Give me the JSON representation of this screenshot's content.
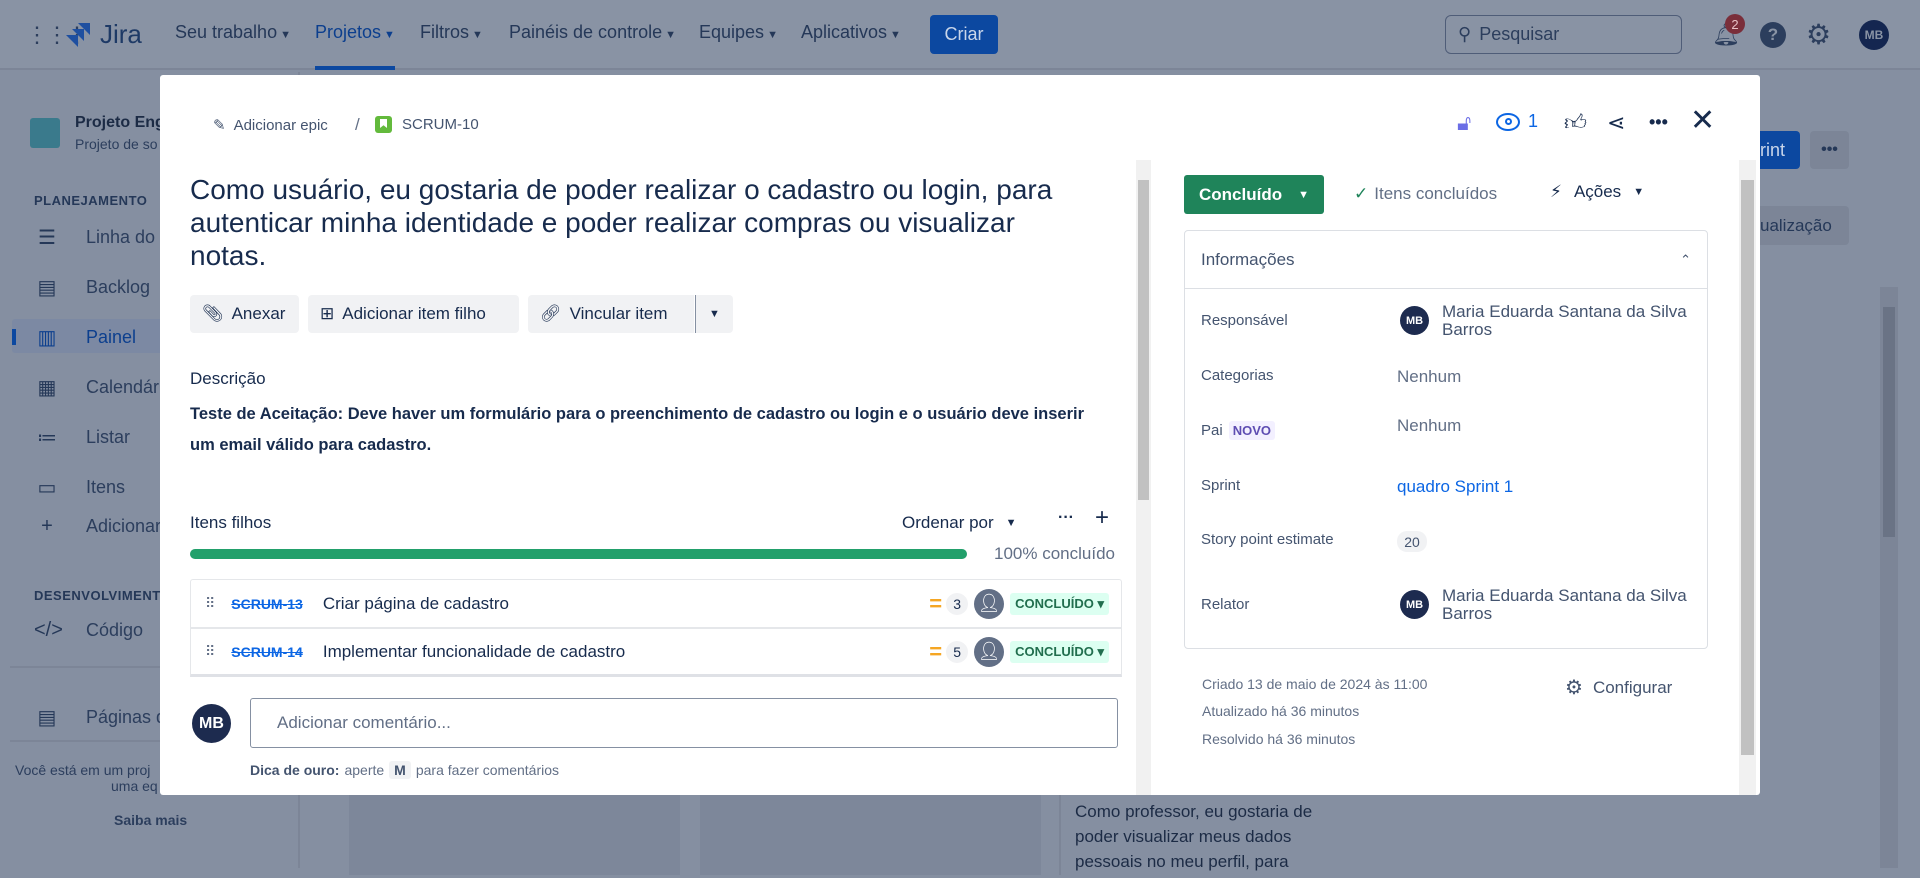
{
  "nav": {
    "product": "Jira",
    "items": [
      "Seu trabalho",
      "Projetos",
      "Filtros",
      "Painéis de controle",
      "Equipes",
      "Aplicativos"
    ],
    "active": "Projetos",
    "create": "Criar",
    "search_placeholder": "Pesquisar",
    "notifications": "2",
    "avatar": "MB"
  },
  "sidebar": {
    "project_name": "Projeto Eng",
    "project_sub": "Projeto de so",
    "planning": "PLANEJAMENTO",
    "items": [
      "Linha do te",
      "Backlog",
      "Painel",
      "Calendário",
      "Listar",
      "Itens",
      "Adicionar v"
    ],
    "dev": "DESENVOLVIMENTO",
    "code": "Código",
    "pages": "Páginas de",
    "footer1": "Você está em um proj",
    "footer2": "uma eq",
    "learn_more": "Saiba mais"
  },
  "background": {
    "sprint_btn": "rint",
    "update_btn": "ualização",
    "card_text": [
      "Como professor, eu gostaria de",
      "poder visualizar meus dados",
      "pessoais no meu perfil, para"
    ]
  },
  "issue": {
    "breadcrumb": {
      "epic": "Adicionar epic",
      "key": "SCRUM-10"
    },
    "watchers": "1",
    "title": "Como usuário, eu gostaria de poder realizar o cadastro ou login, para autenticar minha identidade e poder realizar compras ou visualizar notas.",
    "actions": {
      "attach": "Anexar",
      "add_child": "Adicionar item filho",
      "link": "Vincular item"
    },
    "description_label": "Descrição",
    "description": "Teste de Aceitação: Deve haver um formulário para o preenchimento de cadastro ou login e o usuário deve inserir um email válido para cadastro.",
    "children": {
      "label": "Itens filhos",
      "sort": "Ordenar por",
      "progress_percent": 100,
      "progress_text": "100% concluído",
      "items": [
        {
          "key": "SCRUM-13",
          "summary": "Criar página de cadastro",
          "points": "3",
          "status": "CONCLUÍDO"
        },
        {
          "key": "SCRUM-14",
          "summary": "Implementar funcionalidade de cadastro",
          "points": "5",
          "status": "CONCLUÍDO"
        }
      ]
    },
    "comment": {
      "avatar": "MB",
      "placeholder": "Adicionar comentário...",
      "tip_bold": "Dica de ouro:",
      "tip_pre": "aperte",
      "tip_key": "M",
      "tip_post": "para fazer comentários"
    },
    "status": "Concluído",
    "resolution": "Itens concluídos",
    "actions_menu": "Ações",
    "details": {
      "header": "Informações",
      "assignee_label": "Responsável",
      "assignee": "Maria Eduarda Santana da Silva Barros",
      "assignee_avatar": "MB",
      "labels_label": "Categorias",
      "labels": "Nenhum",
      "parent_label": "Pai",
      "parent_badge": "NOVO",
      "parent": "Nenhum",
      "sprint_label": "Sprint",
      "sprint": "quadro Sprint 1",
      "sp_label": "Story point estimate",
      "sp": "20",
      "reporter_label": "Relator",
      "reporter": "Maria Eduarda Santana da Silva Barros",
      "reporter_avatar": "MB"
    },
    "created": "Criado 13 de maio de 2024 às 11:00",
    "updated": "Atualizado há 36 minutos",
    "resolved": "Resolvido há 36 minutos",
    "configure": "Configurar"
  },
  "colors": {
    "accent": "#0c66e4",
    "done": "#1f845a",
    "progress": "#22a06b"
  }
}
